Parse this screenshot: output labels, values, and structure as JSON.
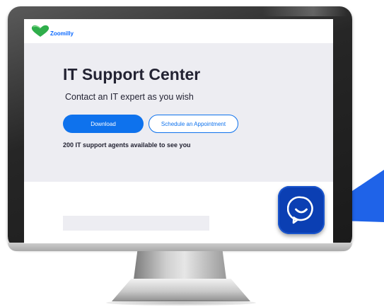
{
  "brand": {
    "name": "Zoomilly",
    "accent_color": "#0e72ed",
    "logo_icon": "heart-logo-icon"
  },
  "hero": {
    "title": "IT Support Center",
    "subtitle": "Contact an IT expert as you wish",
    "download_label": "Download",
    "schedule_label": "Schedule an Appointment",
    "agents_text": "200 IT support agents available to see you"
  },
  "chat": {
    "icon": "chat-bubble-smile-icon",
    "button_color": "#0b3fb3"
  }
}
